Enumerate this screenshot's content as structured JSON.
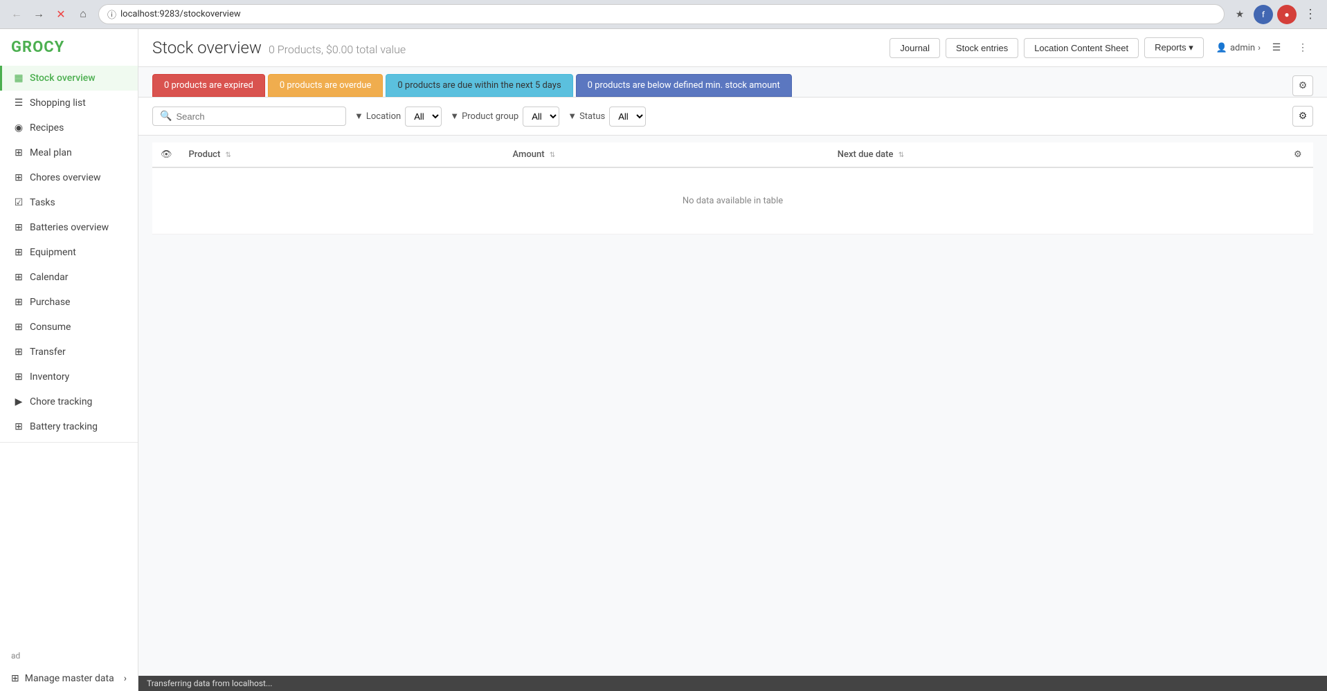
{
  "browser": {
    "url": "localhost:9283/stockoverview",
    "status": "Transferring data from localhost..."
  },
  "app": {
    "logo": "GROCY"
  },
  "sidebar": {
    "items": [
      {
        "id": "stock-overview",
        "label": "Stock overview",
        "icon": "▦",
        "active": true
      },
      {
        "id": "shopping-list",
        "label": "Shopping list",
        "icon": "☰"
      },
      {
        "id": "recipes",
        "label": "Recipes",
        "icon": "📖"
      },
      {
        "id": "meal-plan",
        "label": "Meal plan",
        "icon": "📅"
      },
      {
        "id": "chores-overview",
        "label": "Chores overview",
        "icon": "✓"
      },
      {
        "id": "tasks",
        "label": "Tasks",
        "icon": "☑"
      },
      {
        "id": "batteries-overview",
        "label": "Batteries overview",
        "icon": "🔋"
      },
      {
        "id": "equipment",
        "label": "Equipment",
        "icon": "🔧"
      },
      {
        "id": "calendar",
        "label": "Calendar",
        "icon": "📅"
      },
      {
        "id": "purchase",
        "label": "Purchase",
        "icon": "⊞"
      },
      {
        "id": "consume",
        "label": "Consume",
        "icon": "⊞"
      },
      {
        "id": "transfer",
        "label": "Transfer",
        "icon": "⊞"
      },
      {
        "id": "inventory",
        "label": "Inventory",
        "icon": "⊞"
      },
      {
        "id": "chore-tracking",
        "label": "Chore tracking",
        "icon": "▶"
      },
      {
        "id": "battery-tracking",
        "label": "Battery tracking",
        "icon": "⊞"
      }
    ],
    "ad_label": "ad",
    "manage_master_data": "Manage master data"
  },
  "header": {
    "title": "Stock overview",
    "subtitle": "0 Products, $0.00 total value",
    "user": "admin",
    "buttons": {
      "journal": "Journal",
      "stock_entries": "Stock entries",
      "location_content_sheet": "Location Content Sheet",
      "reports": "Reports ▾"
    }
  },
  "filter_tabs": [
    {
      "id": "expired",
      "label": "0 products are expired",
      "type": "expired"
    },
    {
      "id": "overdue",
      "label": "0 products are overdue",
      "type": "overdue"
    },
    {
      "id": "due-soon",
      "label": "0 products are due within the next 5 days",
      "type": "due-soon"
    },
    {
      "id": "min-stock",
      "label": "0 products are below defined min. stock amount",
      "type": "min-stock"
    }
  ],
  "filters": {
    "search_placeholder": "Search",
    "location_label": "Location",
    "location_value": "All",
    "product_group_label": "Product group",
    "product_group_value": "All",
    "status_label": "Status",
    "status_value": "All"
  },
  "table": {
    "columns": [
      {
        "id": "eye",
        "label": ""
      },
      {
        "id": "product",
        "label": "Product"
      },
      {
        "id": "amount",
        "label": "Amount"
      },
      {
        "id": "next-due-date",
        "label": "Next due date"
      },
      {
        "id": "actions",
        "label": ""
      }
    ],
    "empty_message": "No data available in table",
    "rows": []
  },
  "status_bar": {
    "message": "Transferring data from localhost..."
  }
}
